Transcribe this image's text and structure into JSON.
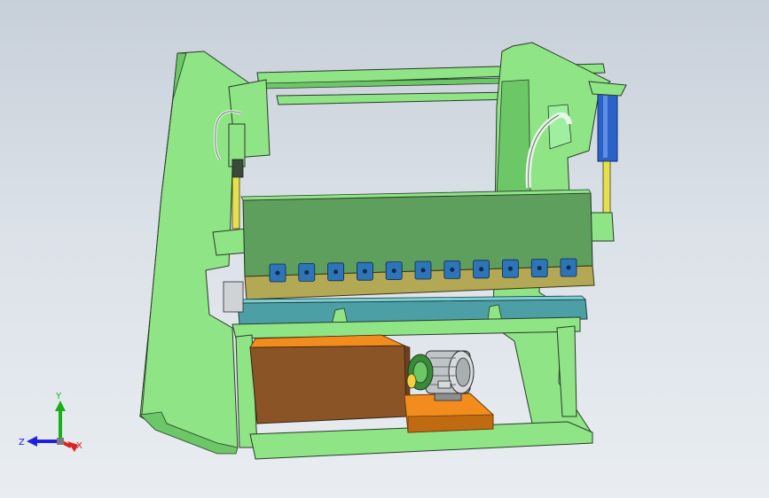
{
  "viewport": {
    "background_top": "#c7cfd9",
    "background_bottom": "#e9edf1"
  },
  "model": {
    "frame_color": "#8fe486",
    "frame_shade": "#6cc766",
    "ram_color": "#5e9f5e",
    "blade_bar_color": "#b3a955",
    "clamp_color": "#2e74b8",
    "table_color": "#4d9fa6",
    "tank_color": "#8a5427",
    "base_color": "#f28d1d",
    "cylinder_color": "#2b62c8",
    "rod_color": "#e7e04d",
    "motor_color": "#bfc4c6",
    "clamp_count": 11
  },
  "triad": {
    "x_label": "X",
    "y_label": "Y",
    "z_label": "Z",
    "x_color": "#e02020",
    "y_color": "#18b018",
    "z_color": "#2020e0"
  }
}
